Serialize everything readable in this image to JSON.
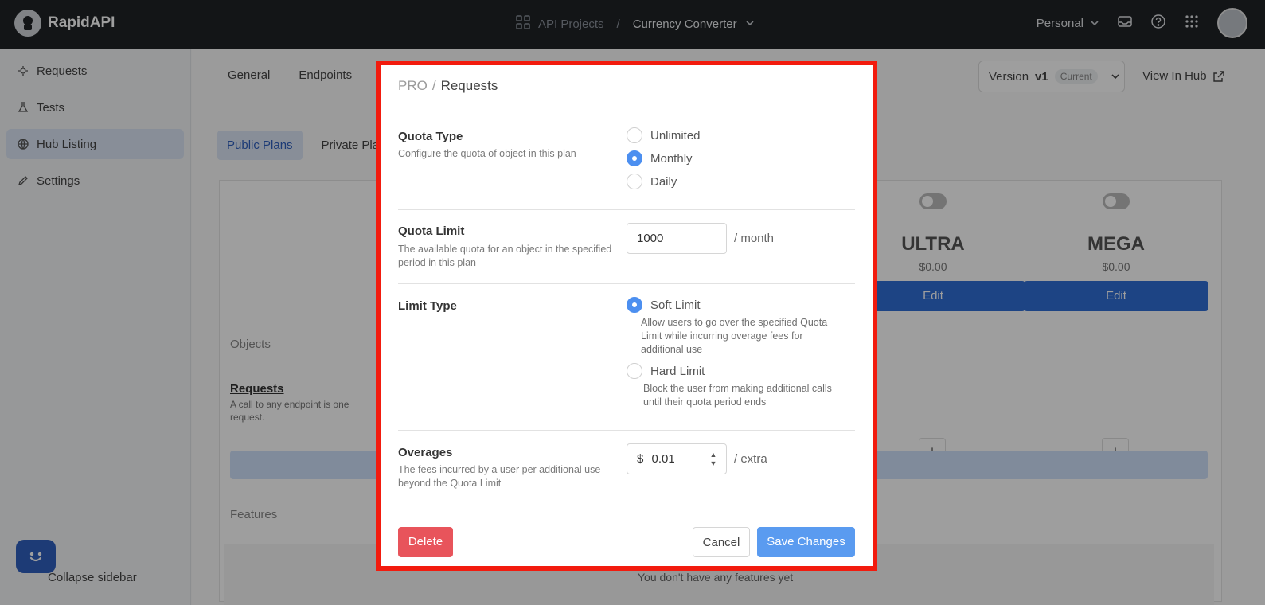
{
  "topbar": {
    "brand": "RapidAPI",
    "crumb_projects": "API Projects",
    "crumb_sep": "/",
    "crumb_current": "Currency Converter",
    "workspace": "Personal"
  },
  "sidebar": {
    "items": [
      {
        "label": "Requests"
      },
      {
        "label": "Tests"
      },
      {
        "label": "Hub Listing"
      },
      {
        "label": "Settings"
      }
    ],
    "collapse_label": "Collapse sidebar"
  },
  "main": {
    "tabs": [
      "General",
      "Endpoints"
    ],
    "version_label": "Version",
    "version_value": "v1",
    "version_tag": "Current",
    "view_in_hub": "View In Hub",
    "plan_tabs": [
      "Public Plans",
      "Private Pla"
    ],
    "plans": [
      {
        "name": "ULTRA",
        "price": "$0.00",
        "edit": "Edit"
      },
      {
        "name": "MEGA",
        "price": "$0.00",
        "edit": "Edit"
      }
    ],
    "objects_label": "Objects",
    "requests_title": "Requests",
    "requests_desc": "A call to any endpoint is one request.",
    "plus": "+",
    "features_label": "Features",
    "features_empty": "You don't have any features yet"
  },
  "modal": {
    "plan": "PRO",
    "sep": "/",
    "title": "Requests",
    "quota_type": {
      "label": "Quota Type",
      "desc": "Configure the quota of object in this plan",
      "options": [
        "Unlimited",
        "Monthly",
        "Daily"
      ],
      "selected": "Monthly"
    },
    "quota_limit": {
      "label": "Quota Limit",
      "desc": "The available quota for an object in the specified period in this plan",
      "value": "1000",
      "unit": "/ month"
    },
    "limit_type": {
      "label": "Limit Type",
      "soft_label": "Soft Limit",
      "soft_desc": "Allow users to go over the specified Quota Limit while incurring overage fees for additional use",
      "hard_label": "Hard Limit",
      "hard_desc": "Block the user from making additional calls until their quota period ends",
      "selected": "Soft Limit"
    },
    "overages": {
      "label": "Overages",
      "desc": "The fees incurred by a user per additional use beyond the Quota Limit",
      "currency": "$",
      "value": "0.01",
      "unit": "/ extra"
    },
    "buttons": {
      "delete": "Delete",
      "cancel": "Cancel",
      "save": "Save Changes"
    }
  },
  "colors": {
    "highlight_border": "#f21b0e",
    "accent": "#4c8ff0",
    "danger": "#e8545b"
  }
}
